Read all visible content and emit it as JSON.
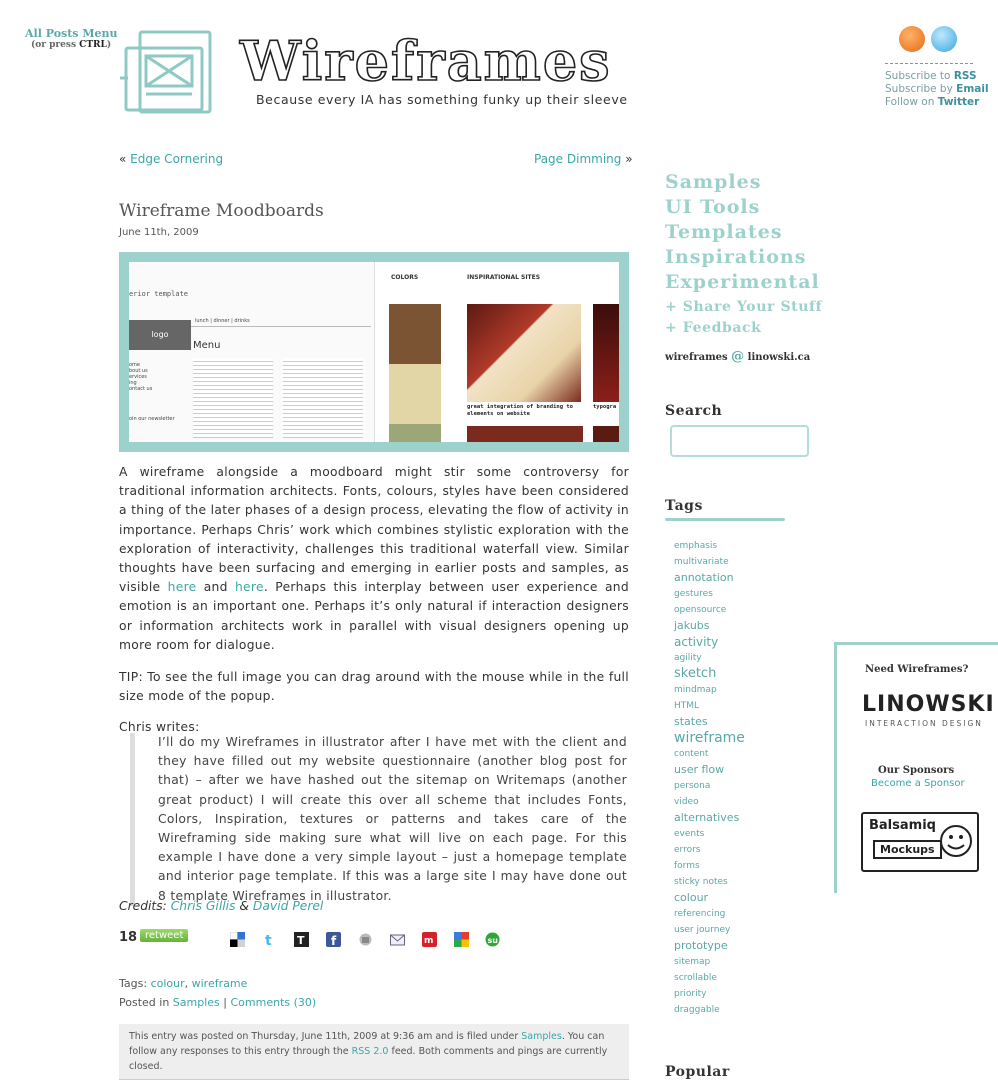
{
  "top_menu": {
    "all_posts": "All Posts Menu",
    "hint_prefix": "(or press ",
    "hint_key": "CTRL",
    "hint_suffix": ")"
  },
  "header": {
    "title": "Wireframes",
    "tagline": "Because every IA has something funky up their sleeve"
  },
  "social": {
    "rss_icon": "rss-icon",
    "twitter_icon": "twitter-bird-icon",
    "subscribe_rss_prefix": "Subscribe to ",
    "subscribe_rss_link": "RSS",
    "subscribe_email_prefix": "Subscribe by ",
    "subscribe_email_link": "Email",
    "follow_prefix": "Follow on ",
    "follow_link": "Twitter"
  },
  "post_nav": {
    "prev_arrow": "«",
    "prev": "Edge Cornering",
    "next": "Page Dimming",
    "next_arrow": "»"
  },
  "post": {
    "title": "Wireframe Moodboards",
    "date": "June 11th, 2009",
    "hero": {
      "colors_label": "COLORS",
      "inspirational_label": "INSPIRATIONAL SITES",
      "interior_label": "erior template",
      "logo_label": "logo",
      "nav_text": "lunch  |  dinner  |  drinks",
      "menu_label": "Menu",
      "side_items": [
        "ome",
        "bout us",
        "ervices",
        "ing",
        "ontact us"
      ],
      "newsletter": "oin our newsletter",
      "caption": "great integration of branding to elements on website",
      "caption2": "typogra",
      "swatches": [
        "#7a5433",
        "#e3d6a6",
        "#9ca777"
      ]
    },
    "p1a": "A wireframe alongside a moodboard might stir some controversy for traditional information architects. Fonts, colours, styles have been considered a thing of the later phases of a design process, elevating the flow of activity in importance. Perhaps Chris’ work which combines stylistic exploration with the exploration of interactivity, challenges this traditional waterfall view. Similar thoughts have been surfacing and emerging in earlier posts and samples, as visible ",
    "p1_link1": "here",
    "p1_and": " and ",
    "p1_link2": "here",
    "p1b": ". Perhaps this interplay between user experience and emotion is an important one. Perhaps it’s only natural if interaction designers or information architects work in parallel with visual designers opening up more room for dialogue.",
    "tip": "TIP: To see the full image you can drag around with the mouse while in the full size mode of the popup.",
    "chris_writes": "Chris writes:",
    "quote": "I’ll do my Wireframes in illustrator after I have met with the client and they have filled out my website questionnaire (another blog post for that) – after we have hashed out the sitemap on Writemaps (another great product) I will create this over all scheme that includes Fonts, Colors, Inspiration, textures or patterns and takes care of the Wireframing side making sure what will live on each page. For this example I have done a very simple layout – just a homepage template and interior page template. If this was a large site I may have done out 8 template Wireframes in illustrator.",
    "credits_label": "Credits: ",
    "credit1": "Chris Gillis",
    "credit_amp": " & ",
    "credit2": "David Perel",
    "retweet_count": "18",
    "retweet_label": "retweet",
    "share_icons": [
      "delicious-icon",
      "twitter-icon",
      "technorati-icon",
      "facebook-icon",
      "digg-icon",
      "email-icon",
      "mixx-icon",
      "google-icon",
      "stumbleupon-icon"
    ],
    "tags_label": "Tags: ",
    "tag1": "colour",
    "tag_sep": ", ",
    "tag2": "wireframe",
    "posted_in": "Posted in ",
    "category": "Samples",
    "sep": " | ",
    "comments": "Comments (30)",
    "meta1": "This entry was posted on Thursday, June 11th, 2009 at 9:36 am and is filed under ",
    "meta_link1": "Samples",
    "meta2": ". You can follow any responses to this entry through the ",
    "meta_link2": "RSS 2.0",
    "meta3": " feed. Both comments and pings are currently closed."
  },
  "sidebar": {
    "nav": [
      "Samples",
      "UI Tools",
      "Templates",
      "Inspirations",
      "Experimental"
    ],
    "share": "+ Share Your Stuff",
    "feedback": "+ Feedback",
    "email_user": "wireframes",
    "email_at": "@",
    "email_domain": "linowski.ca",
    "search_heading": "Search",
    "tags_heading": "Tags",
    "tags": [
      {
        "label": "emphasis",
        "size": "s"
      },
      {
        "label": "multivariate",
        "size": "s"
      },
      {
        "label": "annotation",
        "size": "m"
      },
      {
        "label": "gestures",
        "size": "s"
      },
      {
        "label": "opensource",
        "size": "s"
      },
      {
        "label": "jakubs",
        "size": "m"
      },
      {
        "label": "activity",
        "size": "l"
      },
      {
        "label": "agility",
        "size": "s"
      },
      {
        "label": "sketch",
        "size": "xl"
      },
      {
        "label": "mindmap",
        "size": "s"
      },
      {
        "label": "HTML",
        "size": "s"
      },
      {
        "label": "states",
        "size": "m"
      },
      {
        "label": "wireframe",
        "size": "xxl"
      },
      {
        "label": "content",
        "size": "s"
      },
      {
        "label": "user flow",
        "size": "m"
      },
      {
        "label": "persona",
        "size": "s"
      },
      {
        "label": "video",
        "size": "s"
      },
      {
        "label": "alternatives",
        "size": "m"
      },
      {
        "label": "events",
        "size": "s"
      },
      {
        "label": "errors",
        "size": "s"
      },
      {
        "label": "forms",
        "size": "s"
      },
      {
        "label": "sticky notes",
        "size": "s"
      },
      {
        "label": "colour",
        "size": "m"
      },
      {
        "label": "referencing",
        "size": "s"
      },
      {
        "label": "user journey",
        "size": "s"
      },
      {
        "label": "prototype",
        "size": "m"
      },
      {
        "label": "sitemap",
        "size": "s"
      },
      {
        "label": "scrollable",
        "size": "s"
      },
      {
        "label": "priority",
        "size": "s"
      },
      {
        "label": "draggable",
        "size": "s"
      }
    ],
    "popular_heading": "Popular",
    "sponsor": {
      "need": "Need Wireframes?",
      "linowski": "LINOWSKI",
      "linowski_sub": "INTERACTION DESIGN",
      "our_sponsors": "Our Sponsors",
      "become": "Become a Sponsor",
      "balsamiq": "Balsamiq",
      "mockups": "Mockups"
    }
  },
  "colors": {
    "accent": "#9dd1cc",
    "link": "#3aa7a6"
  }
}
